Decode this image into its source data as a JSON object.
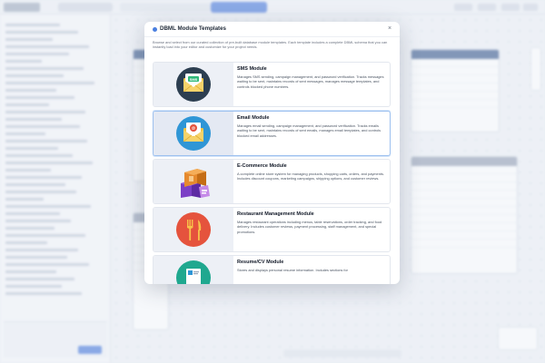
{
  "modal": {
    "title": "DBML Module Templates",
    "close_icon": "×",
    "description": "Browse and select from our curated collection of pre-built database module templates. Each template includes a complete DBML schema that you can instantly load into your editor and customize for your project needs."
  },
  "templates": [
    {
      "title": "SMS Module",
      "description": "Manages SMS sending, campaign management, and password verification. Tracks messages waiting to be sent, maintains records of sent messages, manages message templates, and controls blocked phone numbers.",
      "icon": "sms-envelope-icon",
      "selected": false,
      "badge": "SMS"
    },
    {
      "title": "Email Module",
      "description": "Manages email sending, campaign management, and password verification. Tracks emails waiting to be sent, maintains records of sent emails, manages email templates, and controls blocked email addresses.",
      "icon": "email-envelope-icon",
      "selected": true,
      "badge": "@"
    },
    {
      "title": "E-Commerce Module",
      "description": "A complete online store system for managing products, shopping carts, orders, and payments. Includes discount coupons, marketing campaigns, shipping options, and customer reviews.",
      "icon": "boxes-icon",
      "selected": false
    },
    {
      "title": "Restaurant Management Module",
      "description": "Manages restaurant operations including menus, table reservations, order tracking, and food delivery. Includes customer reviews, payment processing, staff management, and special promotions.",
      "icon": "fork-knife-icon",
      "selected": false
    },
    {
      "title": "Resume/CV Module",
      "description": "Stores and displays personal resume information. Includes sections for",
      "icon": "resume-icon",
      "selected": false
    }
  ],
  "colors": {
    "accent": "#4a7fe0",
    "sms_circle": "#2c3e50",
    "email_circle": "#2f96d6",
    "restaurant_circle": "#e5533d",
    "resume_circle": "#1fa88f"
  }
}
